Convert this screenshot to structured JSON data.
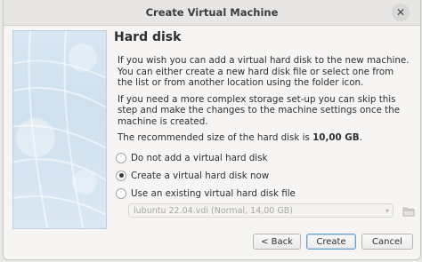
{
  "window": {
    "title": "Create Virtual Machine",
    "close_label": "✕"
  },
  "page": {
    "heading": "Hard disk",
    "intro": "If you wish you can add a virtual hard disk to the new machine. You can either create a new hard disk file or select one from the list or from another location using the folder icon.",
    "advanced": "If you need a more complex storage set-up you can skip this step and make the changes to the machine settings once the machine is created.",
    "recommended_prefix": "The recommended size of the hard disk is ",
    "recommended_size": "10,00 GB",
    "recommended_suffix": "."
  },
  "options": [
    {
      "label": "Do not add a virtual hard disk",
      "checked": false
    },
    {
      "label": "Create a virtual hard disk now",
      "checked": true
    },
    {
      "label": "Use an existing virtual hard disk file",
      "checked": false
    }
  ],
  "existing_disk": {
    "selected": "lubuntu 22.04.vdi (Normal, 14,00 GB)",
    "arrow": "▾",
    "enabled": false
  },
  "buttons": {
    "back": "< Back",
    "create": "Create",
    "cancel": "Cancel"
  }
}
